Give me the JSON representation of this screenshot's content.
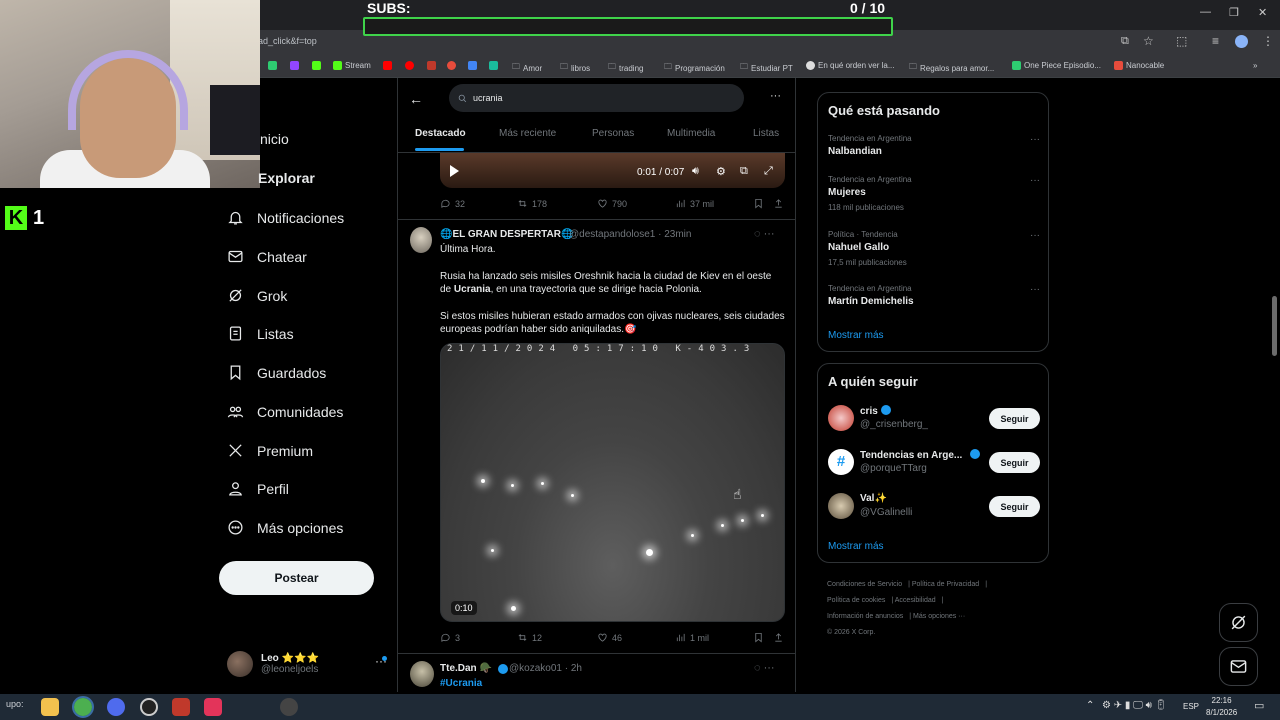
{
  "overlay": {
    "subs_label": "SUBS:",
    "subs_count": "0  / 10",
    "subs_progress": 0
  },
  "kick": {
    "count": "1",
    "logo_letter": "K"
  },
  "browser": {
    "url_fragment": "ad_click&f=top",
    "bookmarks": [
      "Stream",
      "Amor",
      "libros",
      "trading",
      "Programación",
      "Estudiar PT",
      "En qué orden ver la...",
      "Regalos para amor...",
      "One Piece Episodio...",
      "Nanocable"
    ]
  },
  "nav": {
    "items": [
      {
        "label": "nicio",
        "icon": "home-icon"
      },
      {
        "label": "Explorar",
        "icon": "search-icon"
      },
      {
        "label": "Notificaciones",
        "icon": "bell-icon"
      },
      {
        "label": "Chatear",
        "icon": "mail-icon"
      },
      {
        "label": "Grok",
        "icon": "grok-icon"
      },
      {
        "label": "Listas",
        "icon": "list-icon"
      },
      {
        "label": "Guardados",
        "icon": "bookmark-icon"
      },
      {
        "label": "Comunidades",
        "icon": "people-icon"
      },
      {
        "label": "Premium",
        "icon": "x-logo-icon"
      },
      {
        "label": "Perfil",
        "icon": "person-icon"
      },
      {
        "label": "Más opciones",
        "icon": "more-circle-icon"
      }
    ],
    "post_button": "Postear",
    "account": {
      "name": "Leo ⭐⭐⭐",
      "handle": "@leoneljoels"
    }
  },
  "search": {
    "query": "ucrania"
  },
  "tabs": [
    "Destacado",
    "Más reciente",
    "Personas",
    "Multimedia",
    "Listas"
  ],
  "video1": {
    "time": "0:01 / 0:07"
  },
  "actions1": {
    "replies": "32",
    "reposts": "178",
    "likes": "790",
    "views": "37 mil"
  },
  "tweet": {
    "name": "🌐EL GRAN DESPERTAR🌐",
    "handle": "@destapandolose1 · 23min",
    "line1": "Última Hora.",
    "para1_a": "Rusia ha lanzado seis misiles Oreshnik hacia la ciudad de Kiev en el oeste de ",
    "para1_b": "Ucrania",
    "para1_c": ", en una trayectoria que se dirige hacia Polonia.",
    "para2": "Si estos misiles hubieran estado armados con ojivas nucleares, seis ciudades europeas podrían haber sido aniquiladas.🎯",
    "video_stamp": "21/11/2024 05:17:10  K-403.3",
    "video_duration": "0:10"
  },
  "actions2": {
    "replies": "3",
    "reposts": "12",
    "likes": "46",
    "views": "1 mil"
  },
  "tweet2": {
    "name": "Tte.Dan 🪖",
    "handle": "@kozako01 · 2h",
    "hashtag": "#Ucrania"
  },
  "trending": {
    "title": "Qué está pasando",
    "items": [
      {
        "context": "Tendencia en Argentina",
        "title": "Nalbandian",
        "count": ""
      },
      {
        "context": "Tendencia en Argentina",
        "title": "Mujeres",
        "count": "118 mil publicaciones"
      },
      {
        "context": "Política · Tendencia",
        "title": "Nahuel Gallo",
        "count": "17,5 mil publicaciones"
      },
      {
        "context": "Tendencia en Argentina",
        "title": "Martín Demichelis",
        "count": ""
      }
    ],
    "show_more": "Mostrar más"
  },
  "who_to_follow": {
    "title": "A quién seguir",
    "items": [
      {
        "name": "cris",
        "handle": "@_crisenberg_",
        "button": "Seguir"
      },
      {
        "name": "Tendencias en Arge...",
        "handle": "@porqueTTarg",
        "button": "Seguir"
      },
      {
        "name": "Val✨",
        "handle": "@VGalinelli",
        "button": "Seguir"
      }
    ],
    "show_more": "Mostrar más"
  },
  "footer": [
    "Condiciones de Servicio",
    "Política de Privacidad",
    "Política de cookies",
    "Accesibilidad",
    "Información de anuncios",
    "Más opciones ···",
    "© 2026 X Corp."
  ],
  "taskbar": {
    "search": "upo:",
    "lang": "ESP",
    "time": "22:16",
    "date": "8/1/2026"
  },
  "colors": {
    "accent": "#1d9bf0",
    "kick_green": "#53fc18",
    "subs_bar_border": "#3fd34a",
    "background": "#000000"
  }
}
